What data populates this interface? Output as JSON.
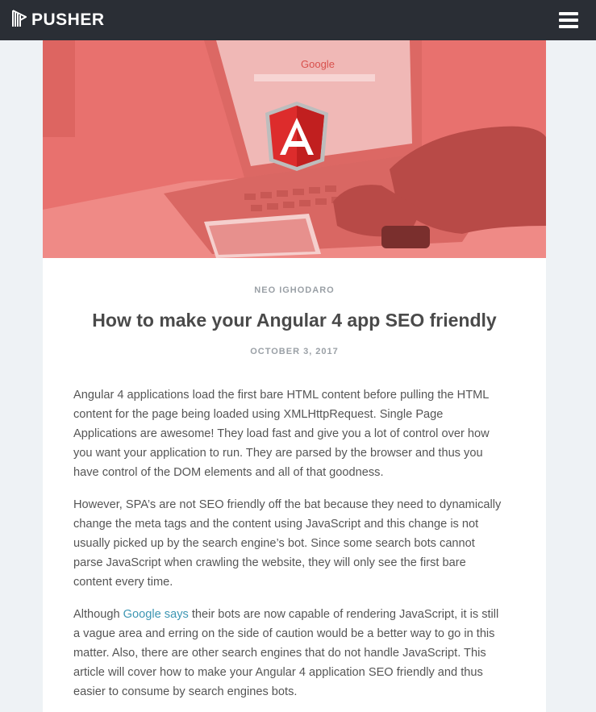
{
  "brand": {
    "name": "PUSHER"
  },
  "colors": {
    "navbar": "#2a2e35",
    "hero_overlay": "#e8716e",
    "link": "#3d96b3",
    "angular_red": "#dd2c2c"
  },
  "icons": {
    "logo": "pusher-logo-icon",
    "menu": "hamburger-menu-icon",
    "hero_badge": "angular-logo-icon"
  },
  "hero": {
    "screen_text": "Google"
  },
  "article": {
    "author": "NEO IGHODARO",
    "title": "How to make your Angular 4 app SEO friendly",
    "date": "OCTOBER 3, 2017",
    "p1_lines": [
      "Angular 4 applications load the first bare HTML content before pulling the HTML",
      "content for the page being loaded using XMLHttpRequest. Single Page",
      "Applications are awesome! They load fast and give you a lot of control over how",
      "you want your application to run. They are parsed by the browser and thus you",
      "have control of the DOM elements and all of that goodness."
    ],
    "p2_lines": [
      "However, SPA’s are not SEO friendly off the bat because they need to dynamically",
      "change the meta tags and the content using JavaScript and this change is not",
      "usually picked up by the search engine’s bot. Since some search bots cannot",
      "parse JavaScript when crawling the website, they will only see the first bare",
      "content every time."
    ],
    "p3_first_prefix": "Although ",
    "p3_link": "Google says",
    "p3_first_suffix": " their bots are now capable of rendering JavaScript, it is still",
    "p3_rest_lines": [
      "a vague area and erring on the side of caution would be a better way to go in this",
      "matter. Also, there are other search engines that do not handle JavaScript. This",
      "article will cover how to make your Angular 4 application SEO friendly and thus",
      "easier to consume by search engines bots."
    ]
  }
}
